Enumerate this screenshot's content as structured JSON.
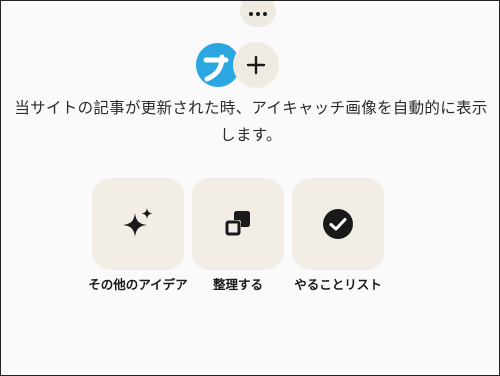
{
  "header": {
    "more_icon": "more-horizontal-icon",
    "app_icon": "app-logo-icon",
    "add_icon": "plus-icon"
  },
  "description": {
    "line1": "当サイトの記事が更新された時、アイキャッチ画像を自動的に表示",
    "line2": "します。"
  },
  "actions": [
    {
      "label": "その他のアイデア",
      "icon": "sparkle-icon"
    },
    {
      "label": "整理する",
      "icon": "organize-icon"
    },
    {
      "label": "やることリスト",
      "icon": "check-circle-icon"
    }
  ],
  "colors": {
    "tile_background": "#f2eee5",
    "app_icon_blue": "#2aa7e0",
    "text": "#1a1a1a"
  }
}
